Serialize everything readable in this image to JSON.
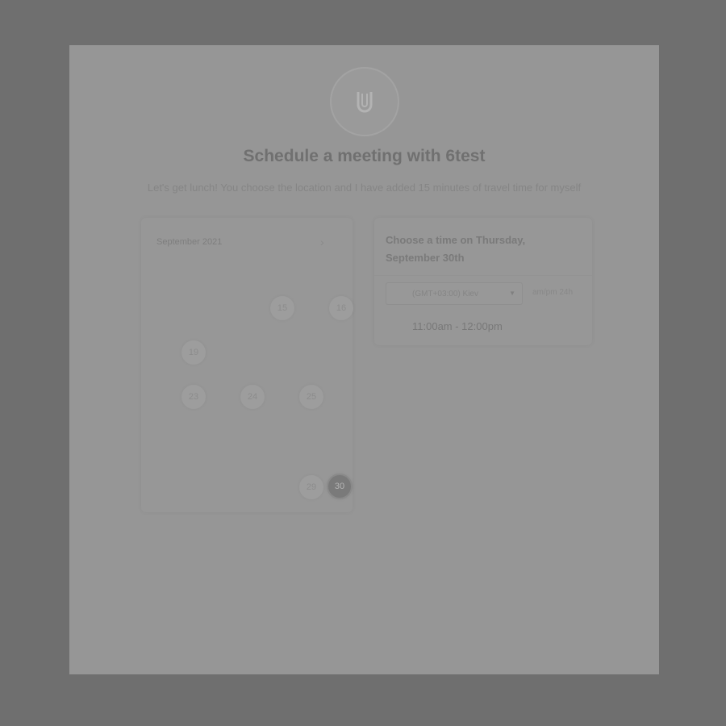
{
  "header": {
    "title": "Schedule a meeting with 6test",
    "subtitle": "Let's get lunch! You choose the location and I have added 15 minutes of travel time for myself"
  },
  "calendar": {
    "month": "September 2021",
    "next_icon": "chevron-right-icon",
    "days": [
      {
        "label": "15",
        "selected": false
      },
      {
        "label": "16",
        "selected": false
      },
      {
        "label": "19",
        "selected": false
      },
      {
        "label": "23",
        "selected": false
      },
      {
        "label": "24",
        "selected": false
      },
      {
        "label": "25",
        "selected": false
      },
      {
        "label": "29",
        "selected": false
      },
      {
        "label": "30",
        "selected": true
      }
    ]
  },
  "times": {
    "heading": "Choose a time on Thursday, September 30th",
    "timezone": "(GMT+03:00) Kiev",
    "format_am_pm": "am/pm",
    "format_24h": "24h",
    "slots": [
      "11:00am - 12:00pm"
    ]
  },
  "colors": {
    "overlay": "#6f6f6f",
    "card": "#969696"
  }
}
